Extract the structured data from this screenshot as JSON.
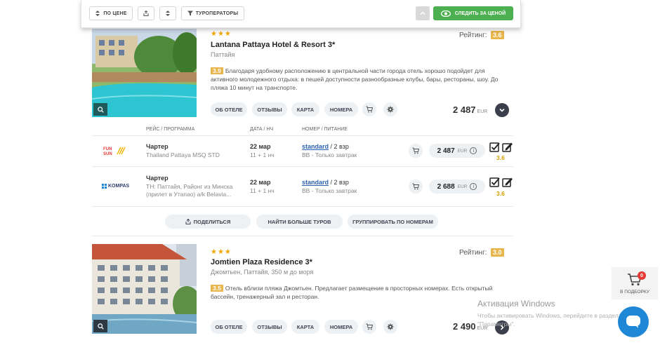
{
  "toolbar": {
    "sort_price_label": "ПО ЦЕНЕ",
    "operators_label": "ТУРОПЕРАТОРЫ",
    "follow_price_label": "СЛЕДИТЬ ЗА ЦЕНОЙ",
    "accent_color": "#4caf50"
  },
  "hotels": [
    {
      "stars": "★★★",
      "name": "Lantana Pattaya Hotel & Resort 3*",
      "location": "Паттайя",
      "rating_label": "Рейтинг:",
      "rating": "3.6",
      "desc_score": "3.9",
      "description": "Благодаря удобному расположению в центральной части города отель хорошо подойдет для активного молодежного отдыха: в пешей доступности разнообразные клубы, бары, рестораны, шоу. До пляжа 10 минут на транспорте.",
      "tabs": [
        "ОБ ОТЕЛЕ",
        "ОТЗЫВЫ",
        "КАРТА",
        "НОМЕРА"
      ],
      "price": "2 487",
      "currency": "EUR"
    },
    {
      "stars": "★★★",
      "name": "Jomtien Plaza Residence 3*",
      "location": "Джомтьен, Паттайя, 350 м до моря",
      "rating_label": "Рейтинг:",
      "rating": "3.0",
      "desc_score": "3.5",
      "description": "Отель вблизи пляжа Джомтьен. Предлагает размещение в просторных номерах. Есть открытый бассейн, тренажерный зал и ресторан.",
      "tabs": [
        "ОБ ОТЕЛЕ",
        "ОТЗЫВЫ",
        "КАРТА",
        "НОМЕРА"
      ],
      "price": "2 490",
      "currency": "EUR"
    }
  ],
  "offers_table": {
    "headers": [
      "РЕЙС / ПРОГРАММА",
      "ДАТА / НЧ",
      "НОМЕР / ПИТАНИЕ"
    ],
    "rows": [
      {
        "operator_logo": "FUN SUN",
        "type": "Чартер",
        "program": "Thailand Pattaya MSQ STD",
        "date": "22 мар",
        "nights": "11 + 1 нч",
        "room_link": "standard",
        "room_rest": " / 2 взр",
        "meal": "BB - Только завтрак",
        "price": "2 487",
        "currency": "EUR",
        "rating": "3.6"
      },
      {
        "operator_logo": "KOMPAS",
        "type": "Чартер",
        "program": "TH: Паттайя, Районг из Минска (прилет в Утапао) a/k Belavia...",
        "date": "22 мар",
        "nights": "11 + 1 нч",
        "room_link": "standard",
        "room_rest": " / 2 взр",
        "meal": "BB - Только завтрак",
        "price": "2 688",
        "currency": "EUR",
        "rating": "3.6"
      }
    ]
  },
  "actions": {
    "share": "ПОДЕЛИТЬСЯ",
    "more_tours": "НАЙТИ БОЛЬШЕ ТУРОВ",
    "group_rooms": "ГРУППИРОВАТЬ ПО НОМЕРАМ"
  },
  "side_cart": {
    "count": "0",
    "label": "В ПОДБОРКУ"
  },
  "windows_notice": {
    "title": "Активация Windows",
    "text": "Чтобы активировать Windows, перейдите в раздел \"Параметры\"."
  }
}
